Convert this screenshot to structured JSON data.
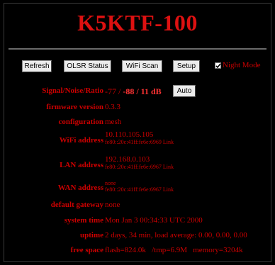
{
  "header": {
    "title": "K5KTF-100"
  },
  "toolbar": {
    "refresh_label": "Refresh",
    "olsr_label": "OLSR Status",
    "wifi_scan_label": "WiFi Scan",
    "setup_label": "Setup",
    "night_mode_label": "Night Mode",
    "night_mode_checked": true
  },
  "status": {
    "signal": {
      "label": "Signal/Noise/Ratio",
      "prefix": "-77 / ",
      "value": "-88 / 11 dB",
      "auto_label": "Auto"
    },
    "firmware": {
      "label": "firmware version",
      "value": "0.3.3"
    },
    "configuration": {
      "label": "configuration",
      "value": "mesh"
    },
    "wifi": {
      "label": "WiFi address",
      "ip": "10.110.105.105",
      "ipv6": "fe80::20c:41ff:fe6e:6969 Link"
    },
    "lan": {
      "label": "LAN address",
      "ip": "192.168.0.103",
      "ipv6": "fe80::20c:41ff:fe6e:6967 Link"
    },
    "wan": {
      "label": "WAN address",
      "ip": "none",
      "ipv6": "fe80::20c:41ff:fe6e:6967 Link"
    },
    "gateway": {
      "label": "default gateway",
      "value": "none"
    },
    "system_time": {
      "label": "system time",
      "value": "Mon Jan 3 00:34:33 UTC 2000"
    },
    "uptime": {
      "label": "uptime",
      "value": "2 days, 34 min, load average: 0.00, 0.00, 0.00"
    },
    "free_space": {
      "label": "free space",
      "value": "flash=824.0k   /tmp=6.9M   memory=3204k"
    }
  },
  "colors": {
    "background": "#000000",
    "text": "#cc0000",
    "title": "#dd1111"
  }
}
